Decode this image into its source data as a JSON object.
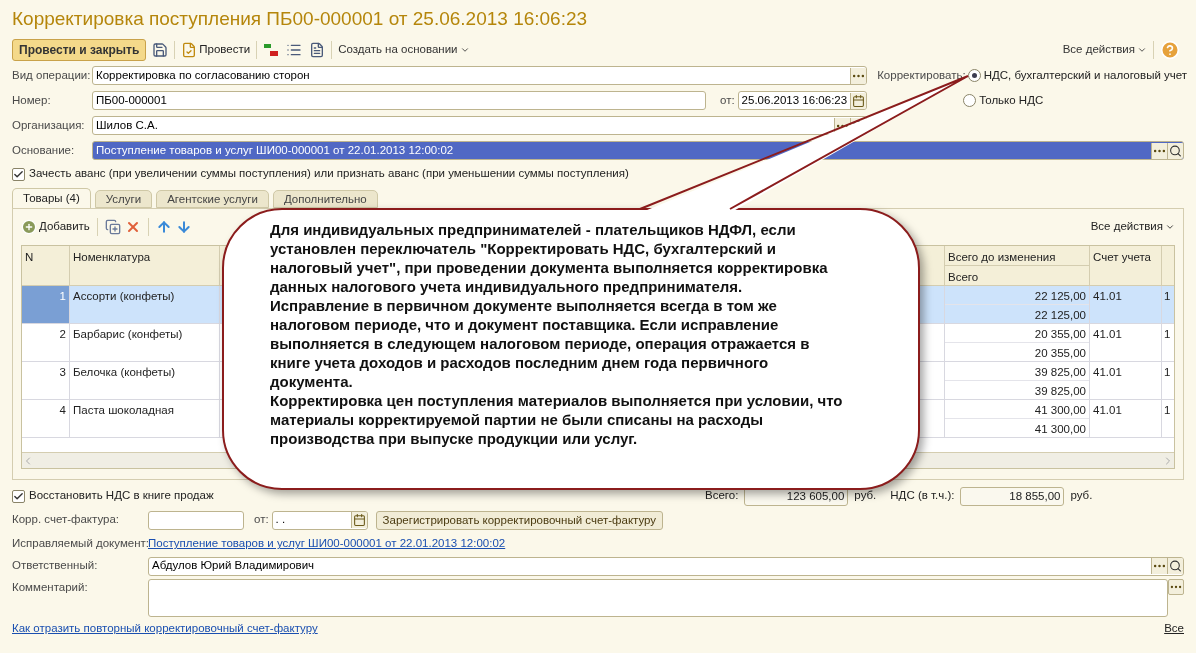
{
  "window": {
    "title": "Корректировка поступления ПБ00-000001 от 25.06.2013 16:06:23"
  },
  "toolbar": {
    "primary": "Провести и закрыть",
    "post": "Провести",
    "create_based": "Создать на основании",
    "all_actions": "Все действия"
  },
  "header_fields": {
    "operation": {
      "label": "Вид операции:",
      "value": "Корректировка по согласованию сторон"
    },
    "number": {
      "label": "Номер:",
      "value": "ПБ00-000001",
      "date_label": "от:",
      "date": "25.06.2013 16:06:23"
    },
    "organization": {
      "label": "Организация:",
      "value": "Шилов С.А."
    },
    "basis": {
      "label": "Основание:",
      "value": "Поступление товаров и услуг ШИ00-000001 от 22.01.2013 12:00:02",
      "selected": true
    }
  },
  "correct": {
    "label": "Корректировать:",
    "options": [
      {
        "label": "НДС, бухгалтерский и налоговый учет",
        "selected": true
      },
      {
        "label": "Только НДС",
        "selected": false
      }
    ]
  },
  "advance": {
    "label": "Зачесть аванс (при увеличении суммы поступления) или признать аванс (при уменьшении суммы поступления)",
    "checked": true
  },
  "tabs": [
    {
      "label": "Товары (4)",
      "selected": true
    },
    {
      "label": "Услуги",
      "selected": false
    },
    {
      "label": "Агентские услуги",
      "selected": false
    },
    {
      "label": "Дополнительно",
      "selected": false
    }
  ],
  "table_toolbar": {
    "add": "Добавить",
    "all_actions": "Все действия"
  },
  "table": {
    "columns": {
      "n": "N",
      "name": "Номенклатура",
      "total_before": "Всего до изменения",
      "total": "Всего",
      "account": "Счет учета"
    },
    "rows": [
      {
        "n": "1",
        "name": "Ассорти (конфеты)",
        "total_before": "22 125,00",
        "total": "22 125,00",
        "account": "41.01",
        "column_7": "1",
        "selected": true
      },
      {
        "n": "2",
        "name": "Барбарис (конфеты)",
        "total_before": "20 355,00",
        "total": "20 355,00",
        "account": "41.01",
        "column_7": "1",
        "selected": false
      },
      {
        "n": "3",
        "name": "Белочка (конфеты)",
        "total_before": "39 825,00",
        "total": "39 825,00",
        "account": "41.01",
        "column_7": "1",
        "selected": false
      },
      {
        "n": "4",
        "name": "Паста шоколадная",
        "total_before": "41 300,00",
        "total": "41 300,00",
        "account": "41.01",
        "column_7": "1",
        "selected": false
      }
    ]
  },
  "callout": {
    "paragraphs": [
      "Для индивидуальных предпринимателей - плательщиков НДФЛ, если установлен переключатель \"Корректировать НДС, бухгалтерский и налоговый учет\", при проведении документа выполняется корректировка данных налогового учета индивидуального предпринимателя.",
      "Исправление в первичном документе выполняется всегда в том же налоговом периоде, что и документ поставщика. Если исправление выполняется в следующем налоговом периоде, операция отражается в книге учета доходов и расходов последним днем года первичного документа.",
      "Корректировка цен поступления материалов выполняется при условии, что материалы корректируемой партии не были списаны на расходы производства при выпуске продукции или услуг."
    ]
  },
  "restore_vat": {
    "label": "Восстановить НДС в книге продаж",
    "checked": true
  },
  "totals": [
    {
      "label": "Всего:",
      "value": "123 605,00",
      "currency": "руб."
    },
    {
      "label": "НДС (в т.ч.):",
      "value": "18 855,00",
      "currency": "руб."
    }
  ],
  "corr_invoice": {
    "label": "Корр. счет-фактура:",
    "date_label": "от:",
    "date": ". .",
    "button": "Зарегистрировать корректировочный счет-фактуру"
  },
  "corrected_document": {
    "label": "Исправляемый документ:",
    "link": "Поступление товаров и услуг ШИ00-000001 от 22.01.2013 12:00:02"
  },
  "responsible": {
    "label": "Ответственный:",
    "value": "Абдулов Юрий Владимирович"
  },
  "comment": {
    "label": "Комментарий:"
  },
  "footer": {
    "help_link": "Как отразить повторный корректировочный счет-фактуру",
    "all_link": "Все"
  }
}
